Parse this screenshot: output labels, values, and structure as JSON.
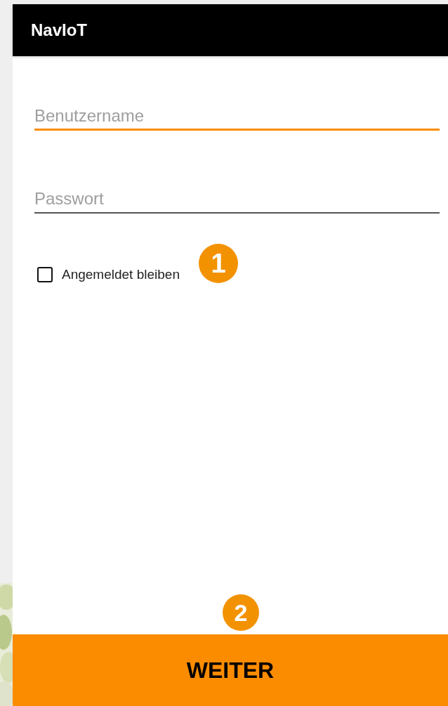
{
  "app_bar": {
    "title": "NavIoT"
  },
  "fields": [
    {
      "placeholder": "Benutzername",
      "focused": true
    },
    {
      "placeholder": "Passwort",
      "focused": false
    }
  ],
  "remember": {
    "label": "Angemeldet bleiben",
    "checked": false
  },
  "submit": {
    "label": "WEITER"
  },
  "annotations": [
    {
      "label": "1"
    },
    {
      "label": "2"
    }
  ]
}
